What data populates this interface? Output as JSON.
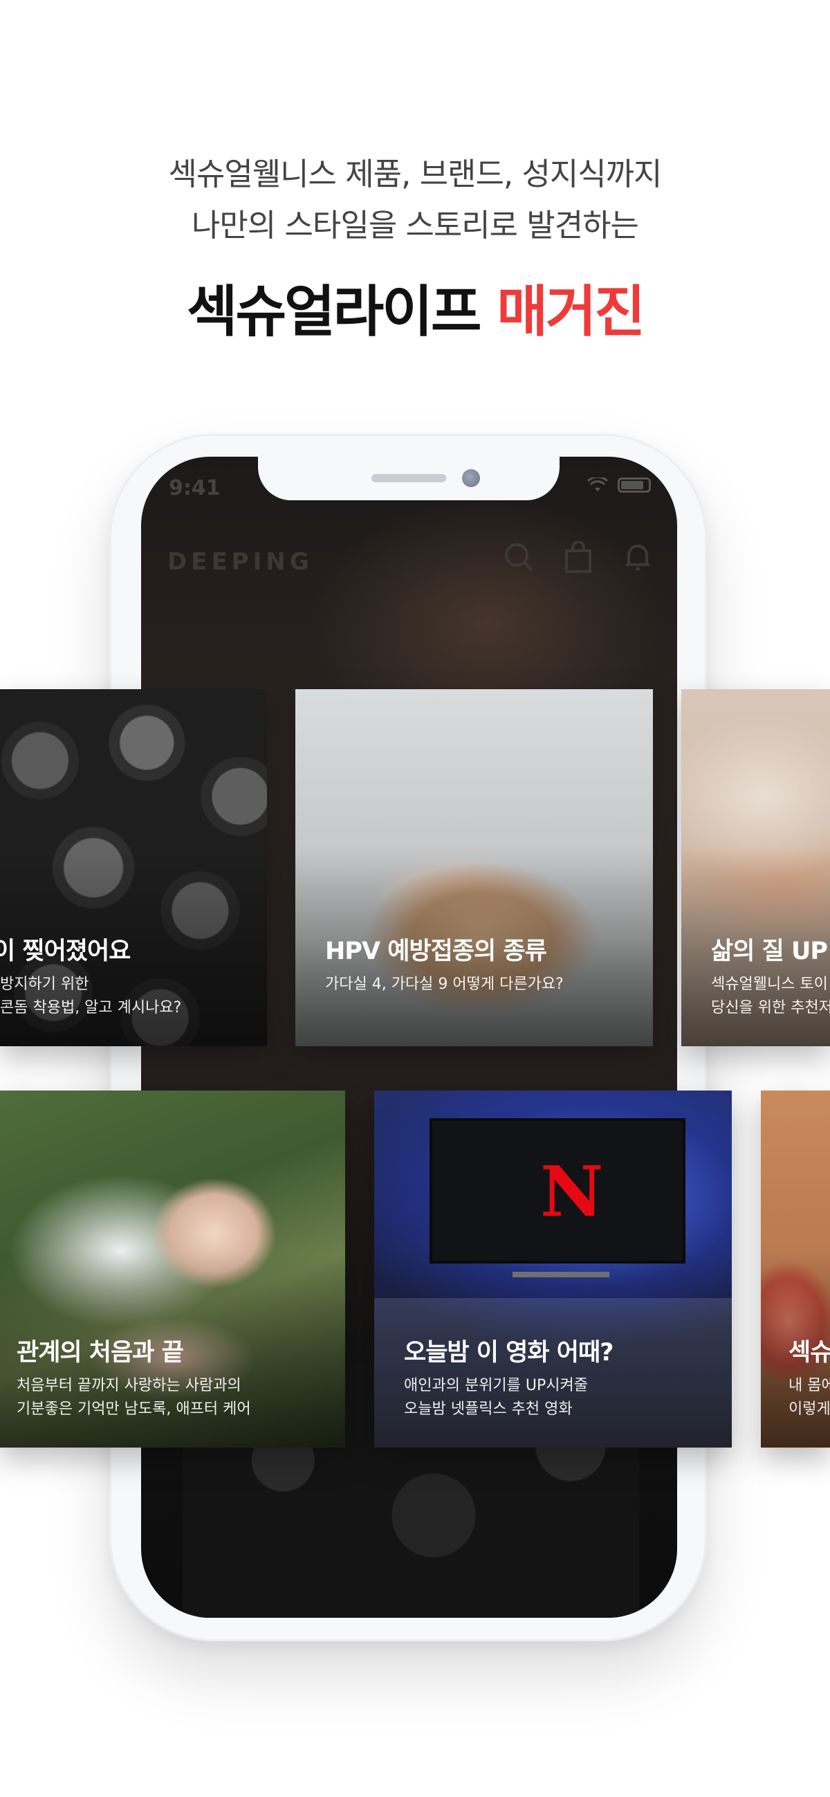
{
  "headline": {
    "line1": "섹슈얼웰니스 제품, 브랜드, 성지식까지",
    "line2": "나만의 스타일을 스토리로 발견하는",
    "title_main": "섹슈얼라이프",
    "title_accent": "매거진",
    "accent_color": "#ef3a3a"
  },
  "phone": {
    "status_time": "9:41",
    "app_logo": "DEEPING",
    "icons": [
      "search-icon",
      "shopping-bag-icon",
      "bell-icon"
    ]
  },
  "cards_row1": [
    {
      "title": "이 찢어졌어요",
      "desc1": "방지하기 위한",
      "desc2": "콘돔 착용법, 알고 계시나요?"
    },
    {
      "title": "HPV 예방접종의 종류",
      "desc1": "가다실 4, 가다실 9 어떻게 다른가요?",
      "desc2": ""
    },
    {
      "title": "삶의 질 UP",
      "desc1": "섹슈얼웰니스 토이",
      "desc2": "당신을 위한 추천저"
    }
  ],
  "cards_row2": [
    {
      "title": "관계의 처음과 끝",
      "desc1": "처음부터 끝까지 사랑하는 사람과의",
      "desc2": "기분좋은 기억만 남도록, 애프터 케어"
    },
    {
      "title": "오늘밤 이 영화 어때?",
      "desc1": "애인과의 분위기를 UP시켜줄",
      "desc2": "오늘밤 넷플릭스 추천 영화"
    },
    {
      "title": "섹슈",
      "desc1": "내 몸에",
      "desc2": "이렇게"
    }
  ],
  "netflix_logo": "N"
}
